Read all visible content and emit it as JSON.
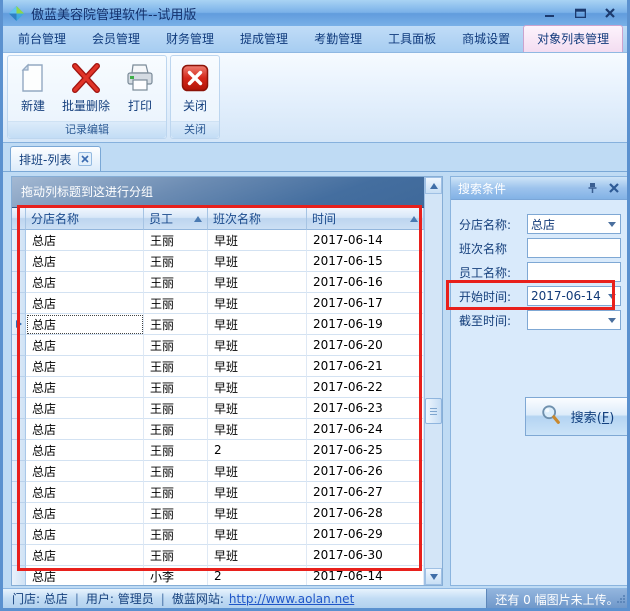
{
  "window": {
    "title": "傲蓝美容院管理软件--试用版",
    "controls": {
      "minimize": "minimize",
      "maximize": "maximize",
      "close": "close"
    }
  },
  "menu_tabs": [
    {
      "label": "前台管理",
      "active": false
    },
    {
      "label": "会员管理",
      "active": false
    },
    {
      "label": "财务管理",
      "active": false
    },
    {
      "label": "提成管理",
      "active": false
    },
    {
      "label": "考勤管理",
      "active": false
    },
    {
      "label": "工具面板",
      "active": false
    },
    {
      "label": "商城设置",
      "active": false
    },
    {
      "label": "对象列表管理",
      "active": true
    }
  ],
  "ribbon": {
    "groups": [
      {
        "label": "记录编辑",
        "buttons": [
          {
            "label": "新建",
            "icon": "new-page-icon"
          },
          {
            "label": "批量删除",
            "icon": "batch-delete-icon"
          },
          {
            "label": "打印",
            "icon": "printer-icon"
          }
        ]
      },
      {
        "label": "关闭",
        "buttons": [
          {
            "label": "关闭",
            "icon": "close-red-icon"
          }
        ]
      }
    ]
  },
  "doc_tab": {
    "label": "排班-列表"
  },
  "grid": {
    "groupby_hint": "拖动列标题到这进行分组",
    "columns": [
      {
        "label": "分店名称",
        "sorted": false
      },
      {
        "label": "员工",
        "sorted": true
      },
      {
        "label": "班次名称",
        "sorted": false
      },
      {
        "label": "时间",
        "sorted": true
      }
    ],
    "selected_index": 4,
    "rows": [
      [
        "总店",
        "王丽",
        "早班",
        "2017-06-14"
      ],
      [
        "总店",
        "王丽",
        "早班",
        "2017-06-15"
      ],
      [
        "总店",
        "王丽",
        "早班",
        "2017-06-16"
      ],
      [
        "总店",
        "王丽",
        "早班",
        "2017-06-17"
      ],
      [
        "总店",
        "王丽",
        "早班",
        "2017-06-19"
      ],
      [
        "总店",
        "王丽",
        "早班",
        "2017-06-20"
      ],
      [
        "总店",
        "王丽",
        "早班",
        "2017-06-21"
      ],
      [
        "总店",
        "王丽",
        "早班",
        "2017-06-22"
      ],
      [
        "总店",
        "王丽",
        "早班",
        "2017-06-23"
      ],
      [
        "总店",
        "王丽",
        "早班",
        "2017-06-24"
      ],
      [
        "总店",
        "王丽",
        "2",
        "2017-06-25"
      ],
      [
        "总店",
        "王丽",
        "早班",
        "2017-06-26"
      ],
      [
        "总店",
        "王丽",
        "早班",
        "2017-06-27"
      ],
      [
        "总店",
        "王丽",
        "早班",
        "2017-06-28"
      ],
      [
        "总店",
        "王丽",
        "早班",
        "2017-06-29"
      ],
      [
        "总店",
        "王丽",
        "早班",
        "2017-06-30"
      ],
      [
        "总店",
        "小李",
        "2",
        "2017-06-14"
      ]
    ]
  },
  "search_panel": {
    "title": "搜索条件",
    "fields": [
      {
        "label": "分店名称:",
        "value": "总店",
        "type": "dropdown",
        "highlight": false
      },
      {
        "label": "班次名称",
        "value": "",
        "type": "input",
        "highlight": false
      },
      {
        "label": "员工名称:",
        "value": "",
        "type": "input",
        "highlight": false
      },
      {
        "label": "开始时间:",
        "value": "2017-06-14",
        "type": "dropdown",
        "highlight": true
      },
      {
        "label": "截至时间:",
        "value": "",
        "type": "dropdown",
        "highlight": false
      }
    ],
    "search_button_text": "搜索",
    "search_button_hotkey": "F"
  },
  "status_bar": {
    "store": "门店: 总店",
    "user": "用户: 管理员",
    "site_label": "傲蓝网站:",
    "site_url": "http://www.aolan.net",
    "separator": "|",
    "right_text": "还有 0 幅图片未上传。"
  },
  "icons": {
    "logo": "blue-green diamond gem",
    "new-page-icon": "blank page with folded corner",
    "batch-delete-icon": "red X",
    "printer-icon": "printer",
    "close-red-icon": "red square with white x",
    "tab-close-icon": "x",
    "sort-asc-icon": "triangle-up",
    "row-marker-icon": "triangle-right",
    "pin-icon": "push-pin",
    "panel-close-icon": "x",
    "dropdown-icon": "triangle-down",
    "search-icon": "magnifier",
    "scroll-up-icon": "triangle-up",
    "scroll-down-icon": "triangle-down"
  },
  "colors": {
    "accent_red_highlight": "#e8201c",
    "title_bar": "#7ab1e8",
    "active_tab_bg": "#f3ddf1",
    "groupby_bar": "#446e9f",
    "panel_bg": "#d9eafb",
    "link": "#1f56c8"
  }
}
